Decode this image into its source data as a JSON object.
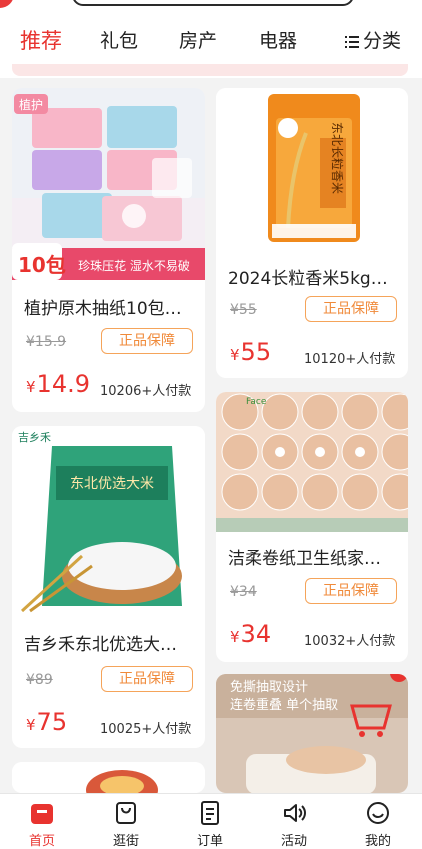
{
  "tabs": [
    {
      "label": "推荐",
      "active": true
    },
    {
      "label": "礼包"
    },
    {
      "label": "房产"
    },
    {
      "label": "电器"
    }
  ],
  "category_label": "分类",
  "products": [
    {
      "title": "植护原木抽纸10包…",
      "badge_brand": "植护",
      "count_badge": "10包",
      "promo": "珍珠压花 湿水不易破",
      "original_price": "¥15.9",
      "guarantee": "正品保障",
      "price_symbol": "¥",
      "price": "14.9",
      "sold": "10206+人付款"
    },
    {
      "title": "2024长粒香米5kg…",
      "bag_text": "东北长粒香米",
      "original_price": "¥55",
      "guarantee": "正品保障",
      "price_symbol": "¥",
      "price": "55",
      "sold": "10120+人付款"
    },
    {
      "title": "吉乡禾东北优选大…",
      "brand": "吉乡禾",
      "bag_text": "东北优选大米",
      "original_price": "¥89",
      "guarantee": "正品保障",
      "price_symbol": "¥",
      "price": "75",
      "sold": "10025+人付款"
    },
    {
      "title": "洁柔卷纸卫生纸家…",
      "wrap_text": "Face",
      "original_price": "¥34",
      "guarantee": "正品保障",
      "price_symbol": "¥",
      "price": "34",
      "sold": "10032+人付款"
    },
    {
      "promo_line1": "免撕抽取设计",
      "promo_line2": "连卷重叠 单个抽取"
    }
  ],
  "nav": [
    {
      "label": "首页",
      "icon": "home-icon",
      "active": true
    },
    {
      "label": "逛街",
      "icon": "shopping-bag-icon"
    },
    {
      "label": "订单",
      "icon": "order-list-icon"
    },
    {
      "label": "活动",
      "icon": "speaker-icon"
    },
    {
      "label": "我的",
      "icon": "smile-face-icon"
    }
  ],
  "colors": {
    "accent": "#e8332f",
    "guarantee": "#f08a3a",
    "background": "#f3f3f3"
  }
}
